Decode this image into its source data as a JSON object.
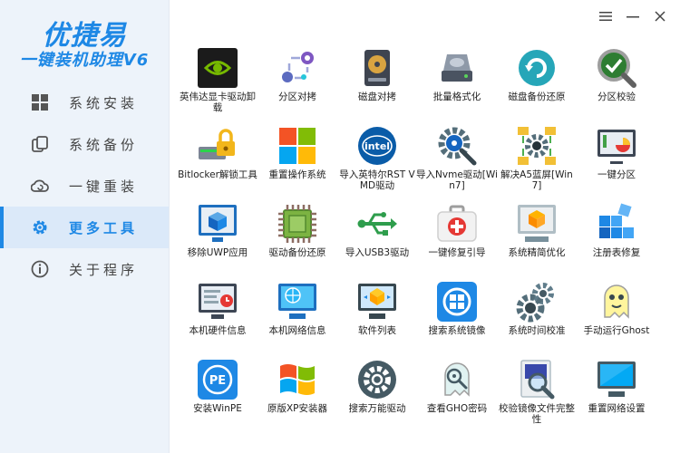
{
  "brand": {
    "title": "优捷易",
    "subtitle": "一键装机助理V6"
  },
  "nav": [
    {
      "label": "系统安装",
      "icon": "windows-icon",
      "active": false
    },
    {
      "label": "系统备份",
      "icon": "backup-copy-icon",
      "active": false
    },
    {
      "label": "一键重装",
      "icon": "cloud-refresh-icon",
      "active": false
    },
    {
      "label": "更多工具",
      "icon": "gear-icon",
      "active": true
    },
    {
      "label": "关于程序",
      "icon": "info-icon",
      "active": false
    }
  ],
  "colors": {
    "accent": "#1e88e5",
    "sidebar_bg": "#edf3fa",
    "active_bg": "#dbe9f9"
  },
  "tools": [
    {
      "label": "英伟达显卡驱动卸载",
      "icon": "nvidia-icon"
    },
    {
      "label": "分区对拷",
      "icon": "partition-copy-icon"
    },
    {
      "label": "磁盘对拷",
      "icon": "disk-copy-icon"
    },
    {
      "label": "批量格式化",
      "icon": "batch-format-icon"
    },
    {
      "label": "磁盘备份还原",
      "icon": "disk-restore-icon"
    },
    {
      "label": "分区校验",
      "icon": "partition-check-icon"
    },
    {
      "label": "Bitlocker解锁工具",
      "icon": "bitlocker-lock-icon"
    },
    {
      "label": "重置操作系统",
      "icon": "windows-logo-icon"
    },
    {
      "label": "导入英特尔RST VMD驱动",
      "icon": "intel-icon"
    },
    {
      "label": "导入Nvme驱动[Win7]",
      "icon": "nvme-gear-icon"
    },
    {
      "label": "解决A5蓝屏[Win7]",
      "icon": "bluescreen-fix-icon"
    },
    {
      "label": "一键分区",
      "icon": "one-key-partition-icon"
    },
    {
      "label": "移除UWP应用",
      "icon": "remove-uwp-icon"
    },
    {
      "label": "驱动备份还原",
      "icon": "chip-icon"
    },
    {
      "label": "导入USB3驱动",
      "icon": "usb-icon"
    },
    {
      "label": "一键修复引导",
      "icon": "first-aid-icon"
    },
    {
      "label": "系统精简优化",
      "icon": "system-optimize-icon"
    },
    {
      "label": "注册表修复",
      "icon": "registry-icon"
    },
    {
      "label": "本机硬件信息",
      "icon": "hardware-info-icon"
    },
    {
      "label": "本机网络信息",
      "icon": "network-info-icon"
    },
    {
      "label": "软件列表",
      "icon": "software-list-icon"
    },
    {
      "label": "搜索系统镜像",
      "icon": "search-image-icon"
    },
    {
      "label": "系统时间校准",
      "icon": "time-calibrate-icon"
    },
    {
      "label": "手动运行Ghost",
      "icon": "ghost-icon"
    },
    {
      "label": "安装WinPE",
      "icon": "winpe-icon"
    },
    {
      "label": "原版XP安装器",
      "icon": "xp-logo-icon"
    },
    {
      "label": "搜索万能驱动",
      "icon": "driver-gear-icon"
    },
    {
      "label": "查看GHO密码",
      "icon": "gho-password-icon"
    },
    {
      "label": "校验镜像文件完整性",
      "icon": "image-verify-icon"
    },
    {
      "label": "重置网络设置",
      "icon": "reset-network-icon"
    }
  ]
}
